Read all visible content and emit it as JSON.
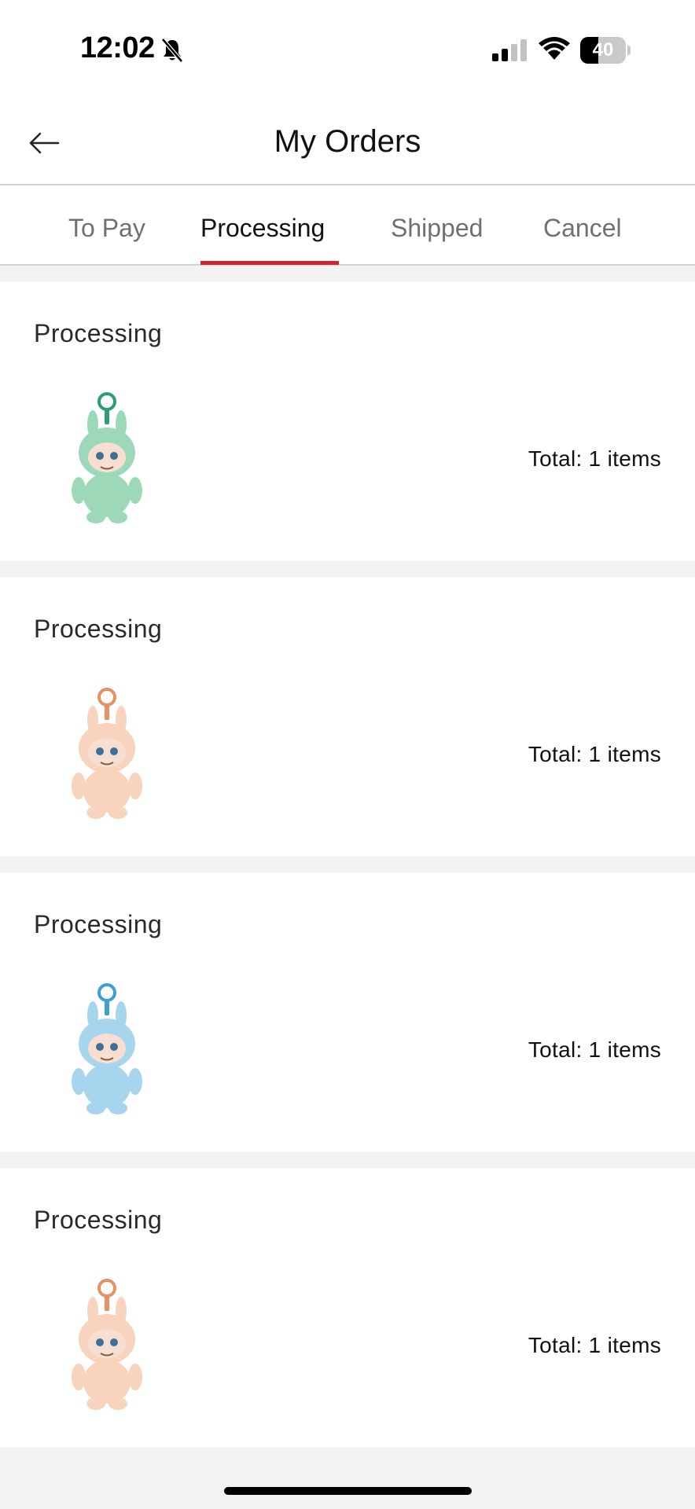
{
  "status_bar": {
    "time": "12:02",
    "battery_percent": "40",
    "battery_level": 0.4,
    "icons": [
      "bell-muted-icon",
      "cellular-signal-icon",
      "wifi-icon",
      "battery-icon"
    ]
  },
  "header": {
    "title": "My Orders",
    "back_icon": "arrow-left-icon"
  },
  "tabs": [
    {
      "label": "To Pay"
    },
    {
      "label": "Processing"
    },
    {
      "label": "Shipped"
    },
    {
      "label": "Cancel"
    }
  ],
  "active_tab": "Processing",
  "accent_color": "#d0242e",
  "orders": [
    {
      "status": "Processing",
      "total": "Total: 1 items",
      "product_color": "#9dd9b9",
      "product_accent": "#2e9d6f"
    },
    {
      "status": "Processing",
      "total": "Total: 1 items",
      "product_color": "#f8d3bd",
      "product_accent": "#e89064"
    },
    {
      "status": "Processing",
      "total": "Total: 1 items",
      "product_color": "#a8d5ee",
      "product_accent": "#3fa0cf"
    },
    {
      "status": "Processing",
      "total": "Total: 1 items",
      "product_color": "#f8d3bd",
      "product_accent": "#e89064"
    }
  ]
}
